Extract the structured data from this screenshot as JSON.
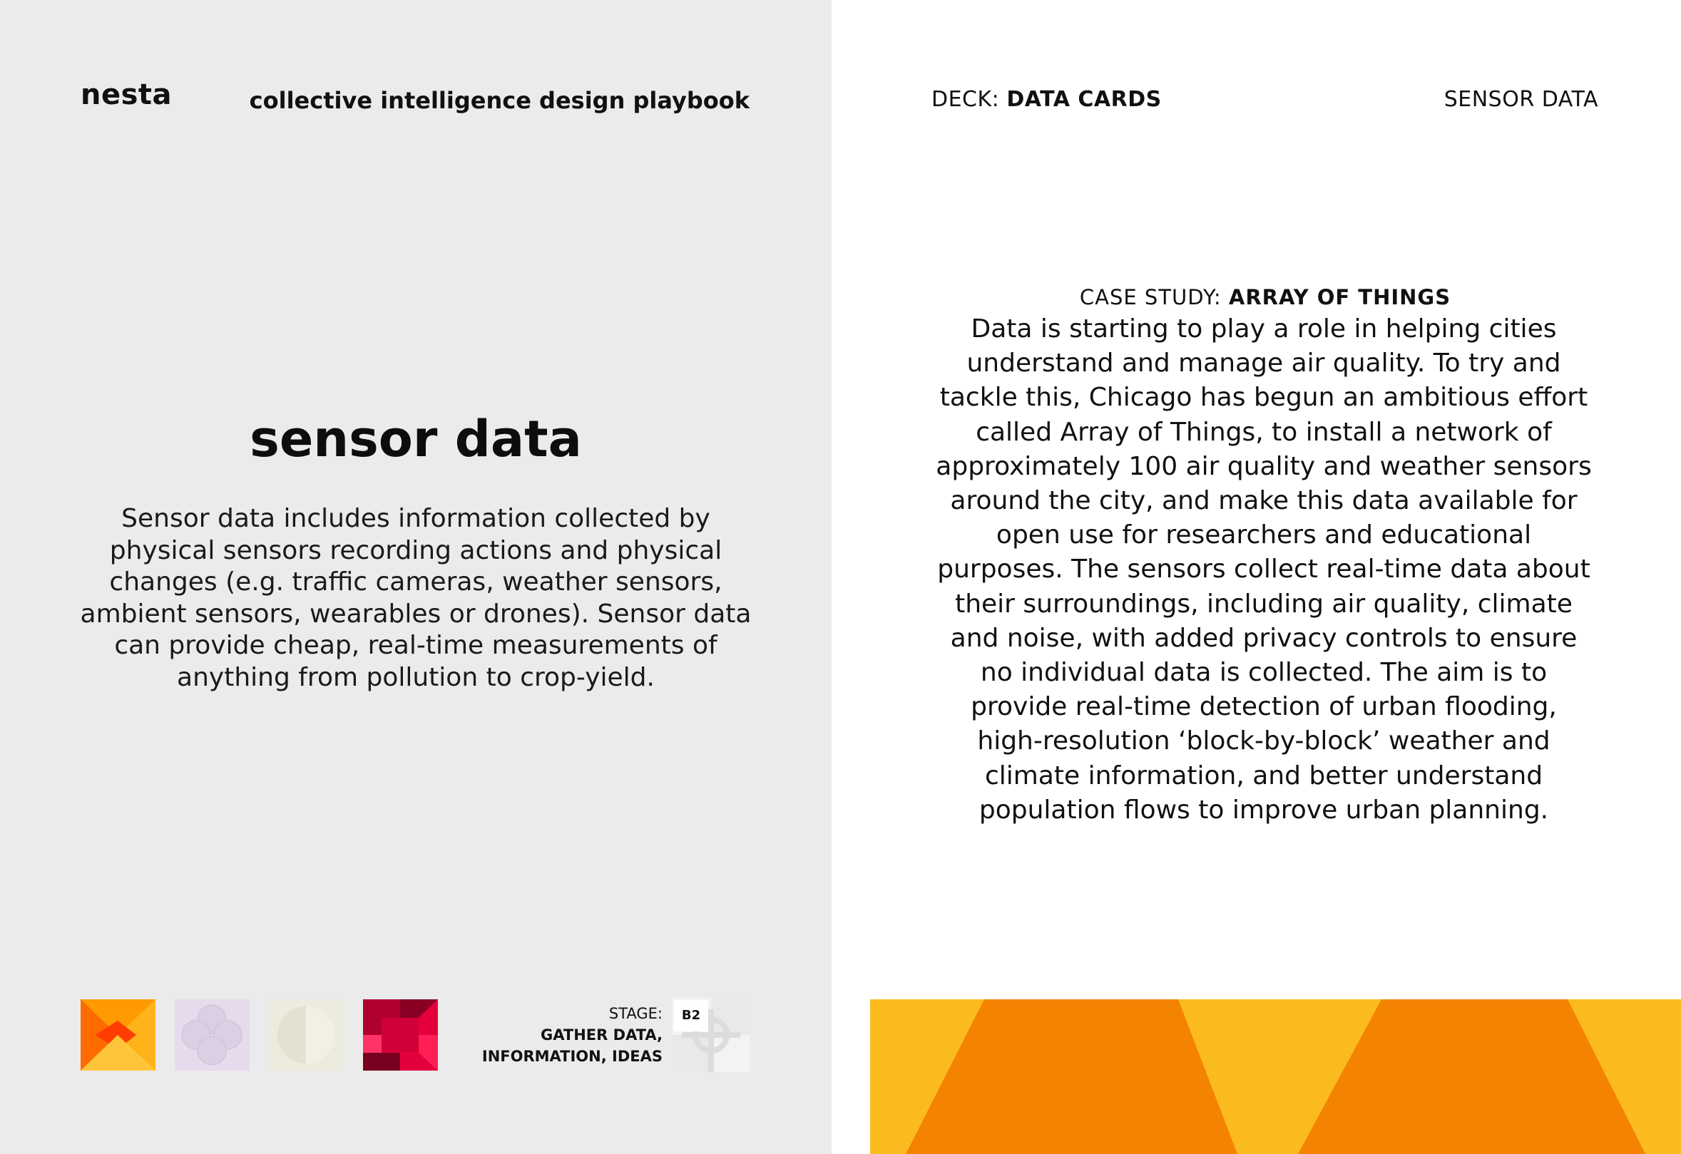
{
  "left_card": {
    "brand": "nesta",
    "playbook_title": "collective intelligence design playbook",
    "title": "sensor data",
    "description": "Sensor data includes information collected by physical sensors recording actions and physical changes (e.g. traffic cameras, weather sensors, ambient sensors, wearables or drones). Sensor data can provide cheap, real-time measurements of anything from pollution to crop-yield.",
    "stage_label": "STAGE:",
    "stage_value_line1": "GATHER DATA,",
    "stage_value_line2": "INFORMATION, IDEAS",
    "stage_code": "B2",
    "icons": [
      "orange-chevron-icon",
      "lilac-circles-icon",
      "beige-halfcircle-icon",
      "red-squares-icon"
    ]
  },
  "right_card": {
    "deck_prefix": "DECK: ",
    "deck_name": "DATA CARDS",
    "card_name": "SENSOR DATA",
    "case_prefix": "CASE STUDY: ",
    "case_name": "ARRAY OF THINGS",
    "case_body": "Data is starting to play a role in helping cities understand and manage air quality. To try and tackle this, Chicago has begun an ambitious effort called Array of Things, to install a network of approximately 100 air quality and weather sensors around the city, and make this data available for open use for researchers and educational purposes. The sensors collect real-time data about their surroundings, including air quality, climate and noise, with added privacy controls to ensure no individual data is collected. The aim is to provide real-time detection of urban flooding, high-resolution ‘block-by-block’ weather and climate information, and better understand population flows to improve urban planning."
  },
  "colors": {
    "left_background": "#ebebeb",
    "right_background": "#ffffff",
    "banner_yellow": "#fbbb1e",
    "banner_orange": "#f58302"
  }
}
